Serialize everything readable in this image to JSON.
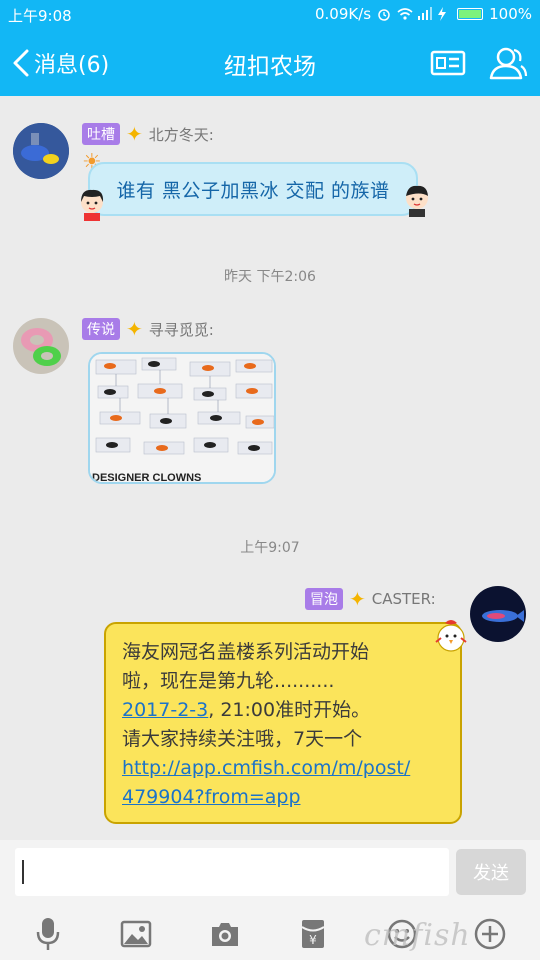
{
  "status_bar": {
    "time": "上午9:08",
    "speed": "0.09K/s",
    "battery": "100%"
  },
  "header": {
    "back_label": "消息(6)",
    "title": "纽扣农场"
  },
  "messages": [
    {
      "badge": "吐槽",
      "sender": "北方冬天:",
      "text": "谁有 黑公子加黑冰 交配 的族谱"
    },
    {
      "timestamp": "昨天 下午2:06"
    },
    {
      "badge": "传说",
      "sender": "寻寻觅觅:",
      "image_caption": "DESIGNER CLOWNS"
    },
    {
      "timestamp": "上午9:07"
    },
    {
      "badge": "冒泡",
      "sender": "CASTER:",
      "line1": "海友网冠名盖楼系列活动开始",
      "line2": "啦，现在是第九轮..........",
      "date_link": "2017-2-3",
      "line3_rest": ", 21:00准时开始。",
      "line4": "请大家持续关注哦，7天一个",
      "url_line1": "http://app.cmfish.com/m/post/",
      "url_line2": "479904?from=app"
    }
  ],
  "input": {
    "value": "",
    "send_label": "发送"
  },
  "watermark": "cmfish",
  "colors": {
    "accent": "#12b7f5",
    "badge": "#a87ce8",
    "yellow_bubble": "#fbe45b",
    "link": "#1b73c9"
  }
}
